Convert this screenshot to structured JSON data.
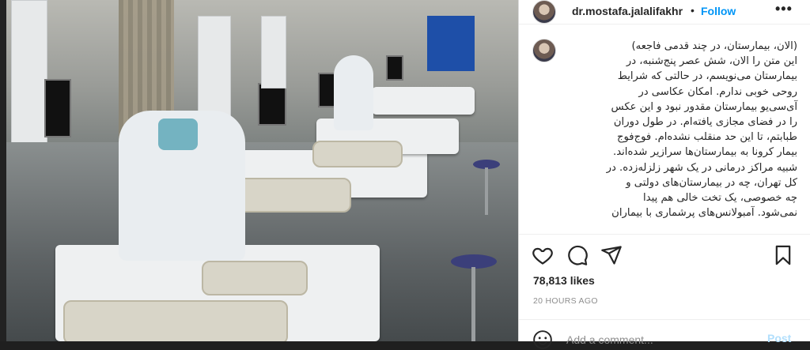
{
  "post": {
    "username": "dr.mostafa.jalalifakhr",
    "separator": "•",
    "follow_label": "Follow",
    "more_icon": "more-options-icon",
    "more_label": "•••",
    "caption": [
      "(الان، بیمارستان، در چند قدمی فاجعه)",
      "این متن را الان، شش عصر پنج‌شنبه، در",
      "بیمارستان می‌نویسم، در حالتی که شرایط",
      "روحی خوبی ندارم. امکان عکاسی در",
      "آی‌سی‌یو بیمارستان مقدور نبود و این عکس",
      "را در فضای مجازی یافته‌ام. در طول دوران",
      "طبابتم، تا این حد منقلب نشده‌ام. فوج‌فوج",
      "بیمار کرونا به بیمارستان‌ها سرازیر شده‌اند.",
      "شبیه مراکز درمانی در یک شهر زلزله‌زده. در",
      "کل تهران، چه در بیمارستان‌های دولتی و",
      "چه خصوصی، یک تخت خالی هم پیدا",
      "نمی‌شود. آمبولانس‌های پرشماری با بیماران"
    ],
    "likes": "78,813 likes",
    "time": "20 HOURS AGO",
    "comment_placeholder": "Add a comment...",
    "post_label": "Post",
    "colors": {
      "follow": "#0095f6",
      "post_disabled": "#b2dffc",
      "text": "#262626",
      "muted": "#8e8e8e"
    },
    "icons": [
      "heart-icon",
      "comment-icon",
      "share-icon",
      "bookmark-icon",
      "emoji-icon"
    ]
  }
}
